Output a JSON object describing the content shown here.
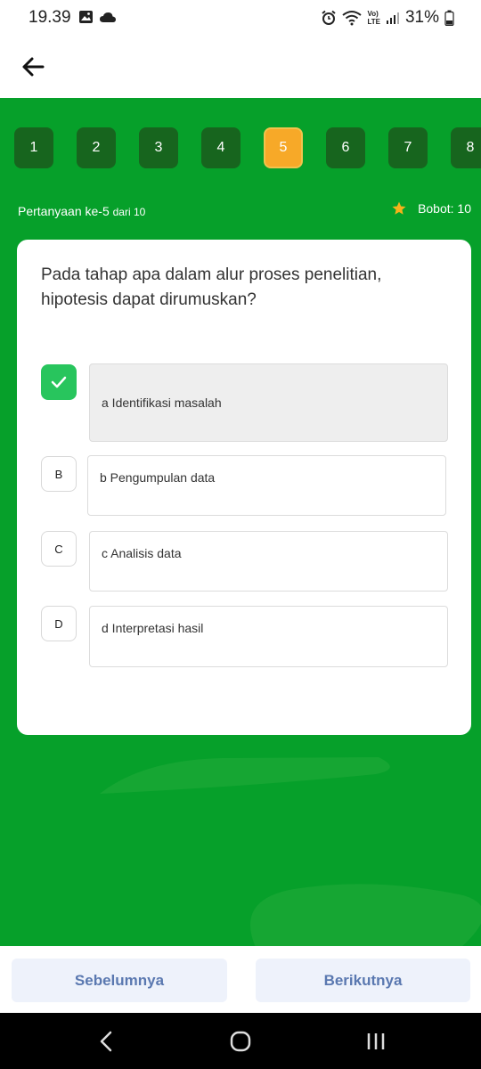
{
  "status_bar": {
    "time": "19.39",
    "battery": "31%",
    "lte": "LTE",
    "volte": "Vo)"
  },
  "quiz": {
    "numbers": [
      "1",
      "2",
      "3",
      "4",
      "5",
      "6",
      "7",
      "8"
    ],
    "current_index": 4,
    "question_label": "Pertanyaan ke-5",
    "question_of": "dari 10",
    "weight": "Bobot: 10",
    "question": "Pada tahap apa dalam alur proses penelitian, hipotesis dapat dirumuskan?",
    "options": [
      {
        "badge": "",
        "text": "a Identifikasi masalah",
        "selected": true
      },
      {
        "badge": "B",
        "text": "b Pengumpulan data",
        "selected": false
      },
      {
        "badge": "C",
        "text": "c Analisis data",
        "selected": false
      },
      {
        "badge": "D",
        "text": "d Interpretasi hasil",
        "selected": false
      }
    ]
  },
  "nav": {
    "prev": "Sebelumnya",
    "next": "Berikutnya"
  },
  "colors": {
    "green_bg": "#06a02a",
    "number_button": "#17651e",
    "active_number": "#f7a928",
    "check": "#28c55d",
    "star": "#f5b21b",
    "nav_text": "#5a78b0"
  },
  "icons": [
    "back-arrow-icon",
    "image-icon",
    "cloud-icon",
    "alarm-icon",
    "wifi-icon",
    "signal-icon",
    "battery-icon",
    "star-icon",
    "check-icon",
    "system-back-icon",
    "system-home-icon",
    "system-recents-icon"
  ]
}
